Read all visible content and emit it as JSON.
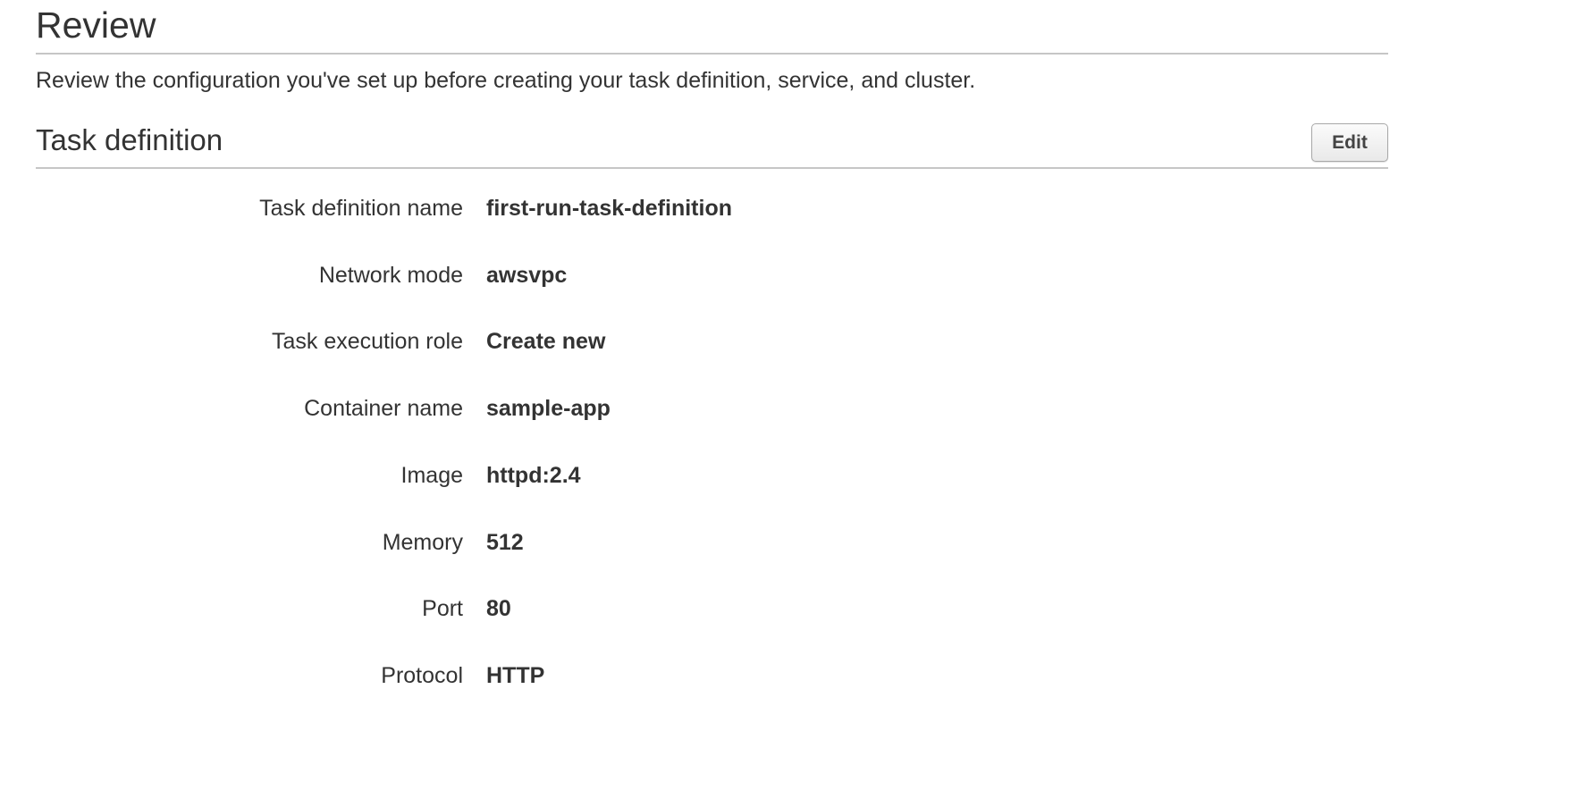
{
  "page": {
    "title": "Review",
    "description": "Review the configuration you've set up before creating your task definition, service, and cluster."
  },
  "section": {
    "title": "Task definition",
    "edit_label": "Edit"
  },
  "details": [
    {
      "label": "Task definition name",
      "value": "first-run-task-definition"
    },
    {
      "label": "Network mode",
      "value": "awsvpc"
    },
    {
      "label": "Task execution role",
      "value": "Create new"
    },
    {
      "label": "Container name",
      "value": "sample-app"
    },
    {
      "label": "Image",
      "value": "httpd:2.4"
    },
    {
      "label": "Memory",
      "value": "512"
    },
    {
      "label": "Port",
      "value": "80"
    },
    {
      "label": "Protocol",
      "value": "HTTP"
    }
  ]
}
